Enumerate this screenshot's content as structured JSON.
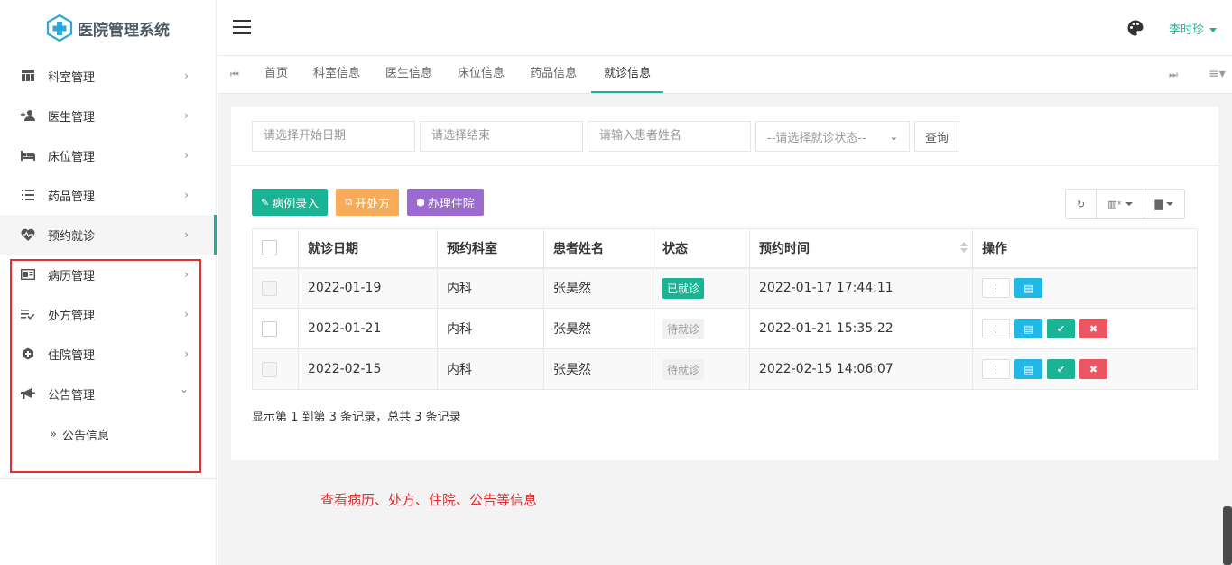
{
  "app": {
    "title": "医院管理系统"
  },
  "sidebar": {
    "items": [
      {
        "label": "科室管理",
        "icon": "table-icon"
      },
      {
        "label": "医生管理",
        "icon": "user-plus-icon"
      },
      {
        "label": "床位管理",
        "icon": "bed-icon"
      },
      {
        "label": "药品管理",
        "icon": "list-icon"
      },
      {
        "label": "预约就诊",
        "icon": "heartbeat-icon"
      },
      {
        "label": "病历管理",
        "icon": "card-icon"
      },
      {
        "label": "处方管理",
        "icon": "list-check-icon"
      },
      {
        "label": "住院管理",
        "icon": "hospital-icon"
      },
      {
        "label": "公告管理",
        "icon": "bullhorn-icon"
      }
    ],
    "submenu": {
      "label": "公告信息"
    },
    "chevron_right": "›",
    "chevron_down": "⌄"
  },
  "header": {
    "user": "李时珍"
  },
  "tabs": [
    "首页",
    "科室信息",
    "医生信息",
    "床位信息",
    "药品信息",
    "就诊信息"
  ],
  "search": {
    "start_placeholder": "请选择开始日期",
    "end_placeholder": "请选择结束",
    "name_placeholder": "请输入患者姓名",
    "status_select": "--请选择就诊状态--",
    "query_label": "查询"
  },
  "toolbar": {
    "record_label": "病例录入",
    "prescribe_label": "开处方",
    "admit_label": "办理住院"
  },
  "table": {
    "columns": [
      "就诊日期",
      "预约科室",
      "患者姓名",
      "状态",
      "预约时间",
      "操作"
    ],
    "rows": [
      {
        "date": "2022-01-19",
        "dept": "内科",
        "patient": "张昊然",
        "status": "已就诊",
        "time": "2022-01-17 17:44:11"
      },
      {
        "date": "2022-01-21",
        "dept": "内科",
        "patient": "张昊然",
        "status": "待就诊",
        "time": "2022-01-21 15:35:22"
      },
      {
        "date": "2022-02-15",
        "dept": "内科",
        "patient": "张昊然",
        "status": "待就诊",
        "time": "2022-02-15 14:06:07"
      }
    ]
  },
  "pager": {
    "summary": "显示第 1 到第 3 条记录，总共 3 条记录"
  },
  "annotation": "查看病历、处方、住院、公告等信息",
  "colors": {
    "accent": "#1ab394",
    "orange": "#f8ac59",
    "purple": "#9b6bd1",
    "blue": "#23b7e5",
    "red": "#ed5565",
    "highlight": "#e62e2e"
  }
}
